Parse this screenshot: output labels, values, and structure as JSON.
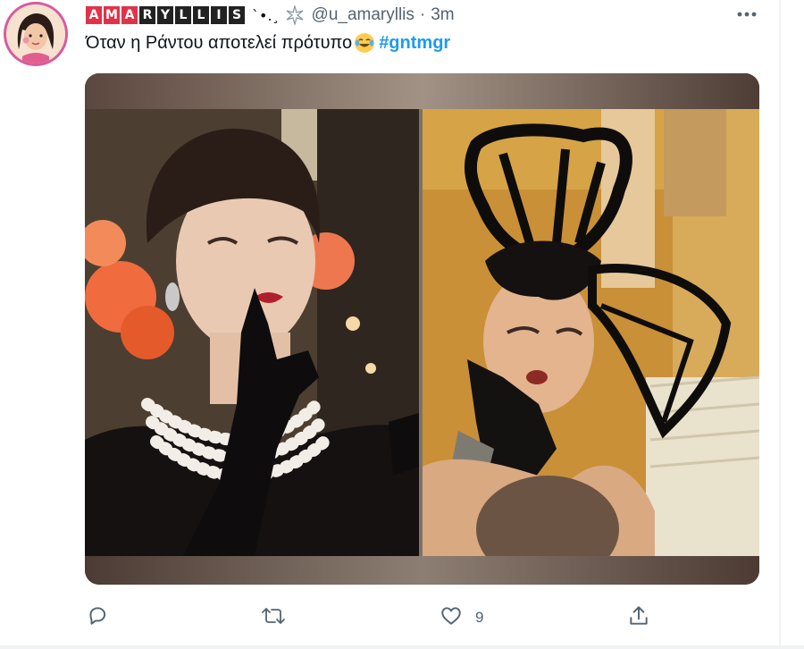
{
  "user": {
    "name_letters": [
      "A",
      "M",
      "A",
      "R",
      "Y",
      "L",
      "L",
      "I",
      "S"
    ],
    "name_suffix": "`•.¸",
    "handle": "@u_amaryllis",
    "separator": "·",
    "time": "3m"
  },
  "tweet": {
    "text": "Όταν η Ράντου αποτελεί πρότυπο",
    "emoji": "face-with-tears-of-joy",
    "hashtag": "#gntmgr"
  },
  "actions": {
    "reply_icon": "reply-icon",
    "retweet_icon": "retweet-icon",
    "like_icon": "like-icon",
    "like_count": "9",
    "share_icon": "share-icon"
  },
  "colors": {
    "link": "#1d9bf0",
    "secondary_text": "#536471",
    "avatar_ring": "#d95a9e",
    "name_red": "#e0334a"
  }
}
